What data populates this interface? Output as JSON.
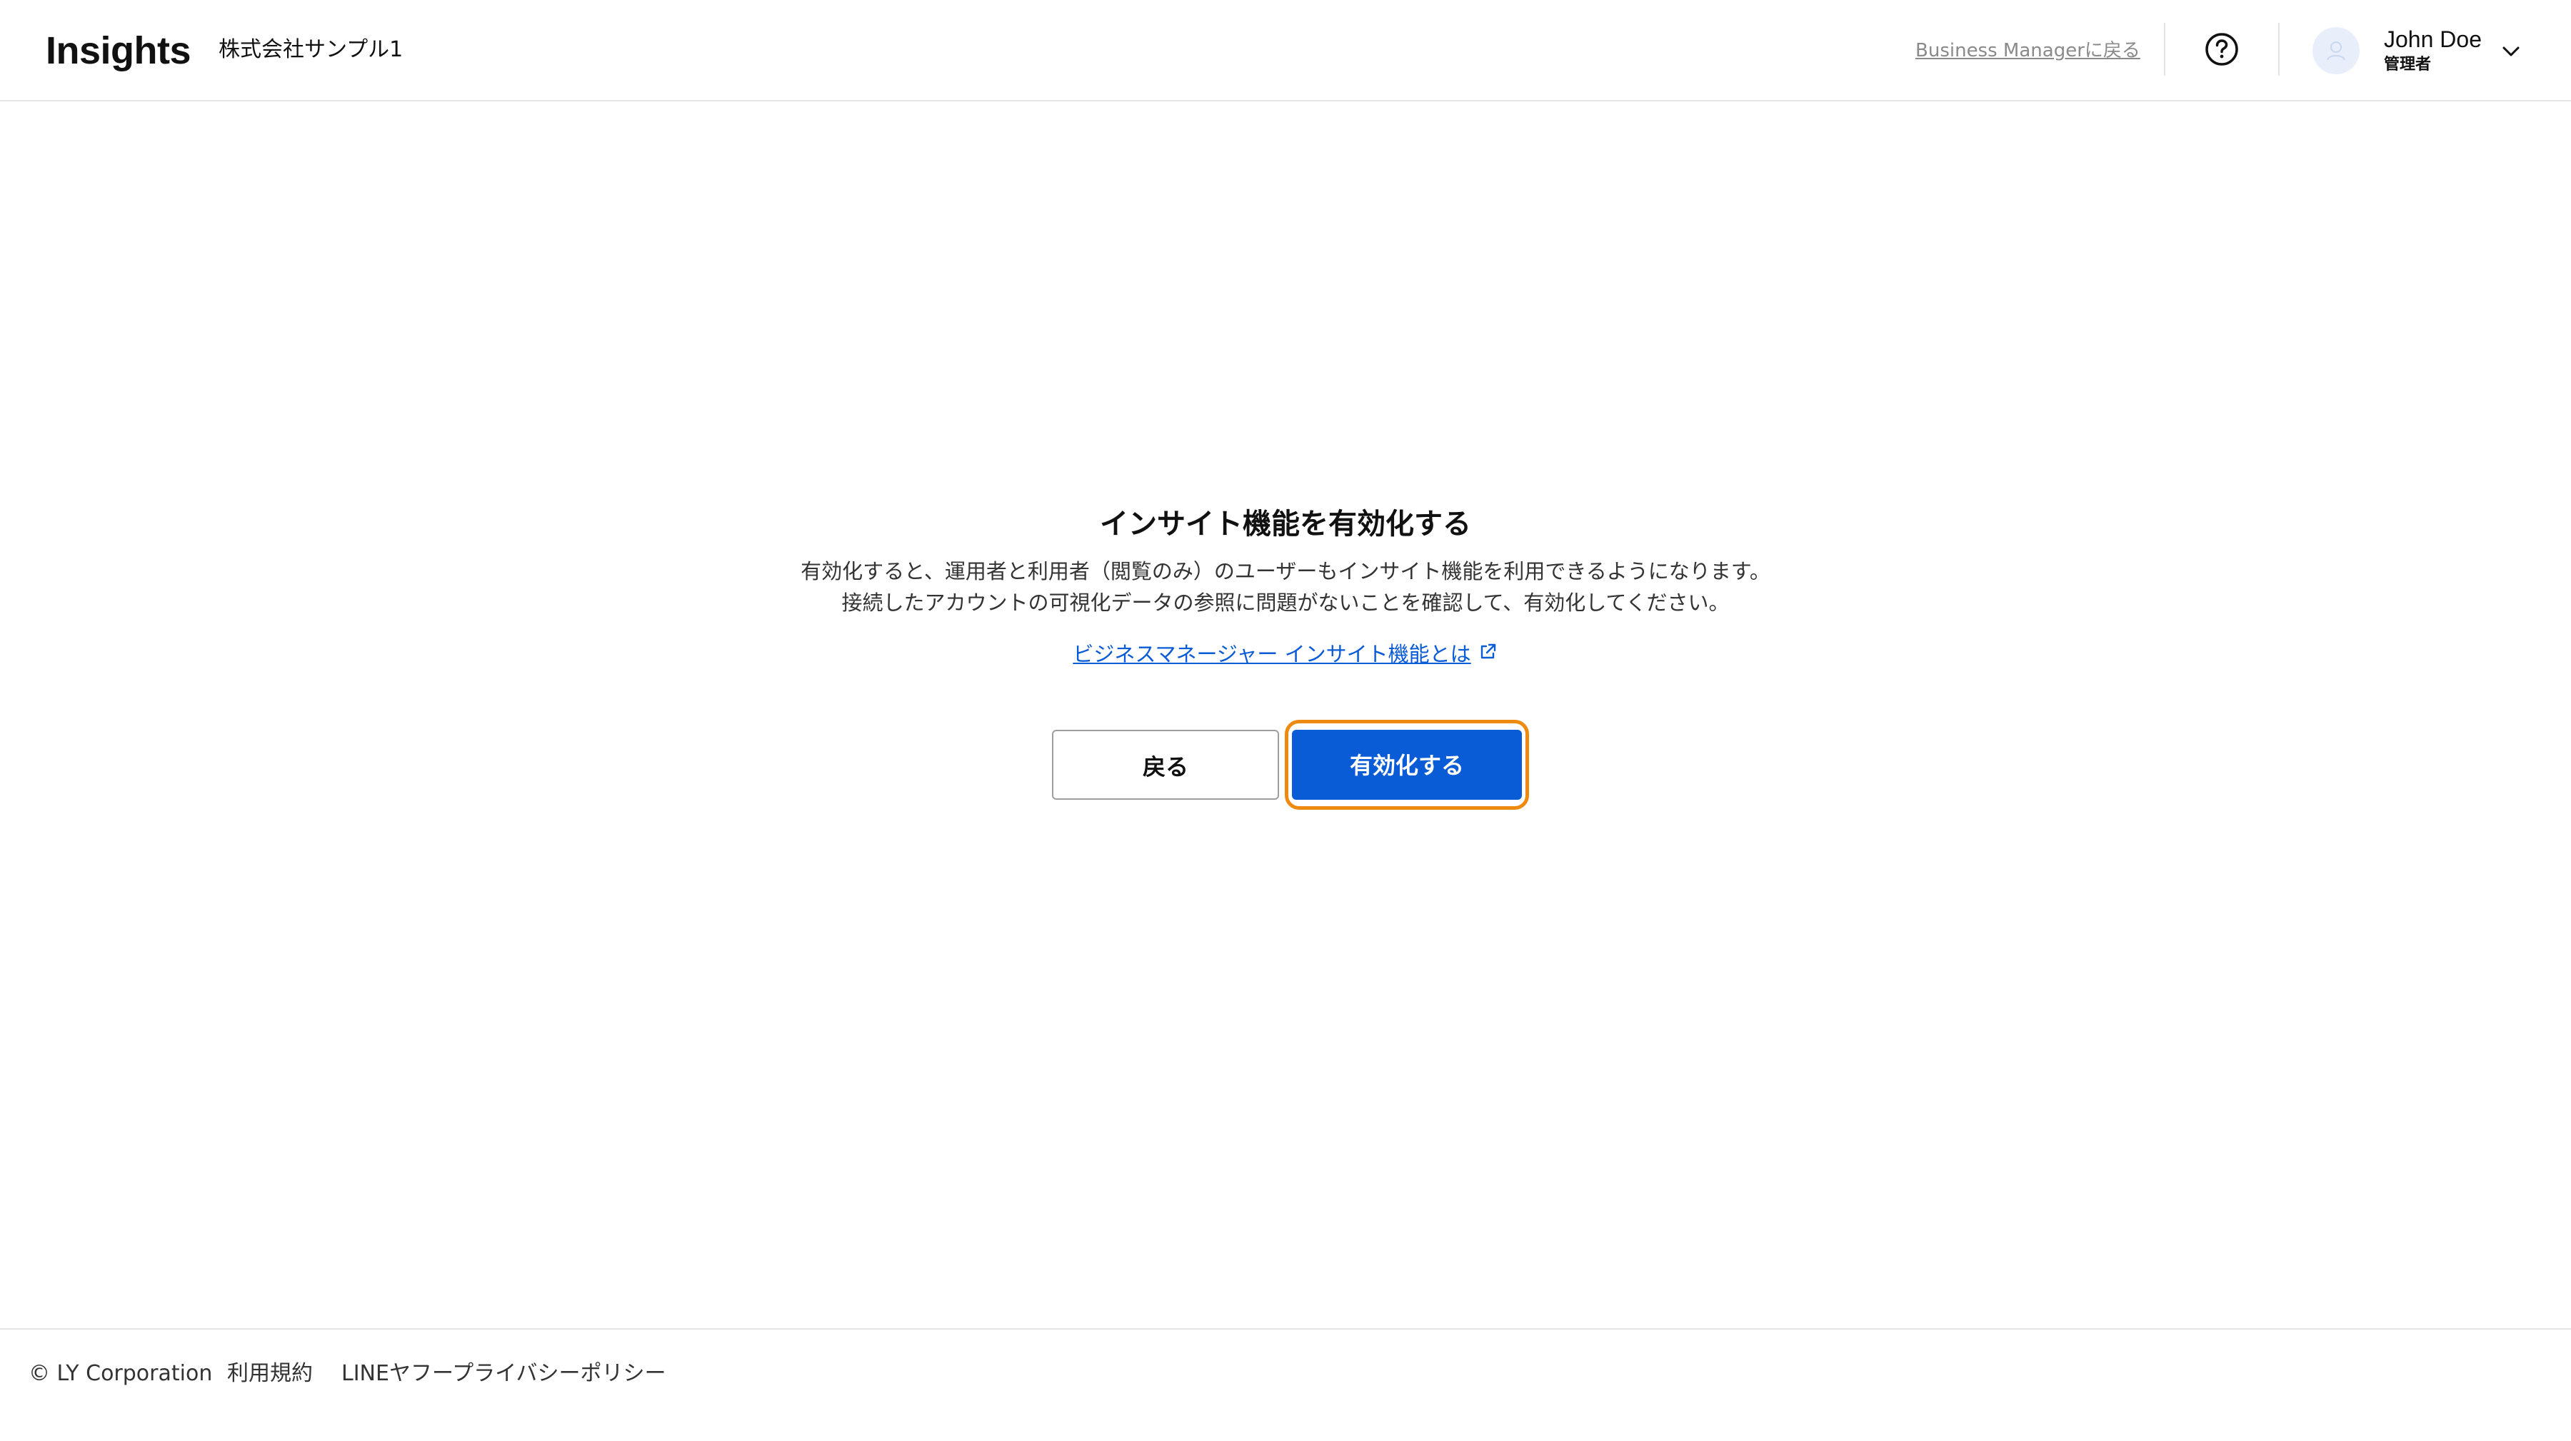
{
  "header": {
    "brand": "Insights",
    "org_name": "株式会社サンプル1",
    "business_manager_link": "Business Managerに戻る",
    "user": {
      "name": "John Doe",
      "role": "管理者"
    }
  },
  "main": {
    "title": "インサイト機能を有効化する",
    "description_line1": "有効化すると、運用者と利用者（閲覧のみ）のユーザーもインサイト機能を利用できるようになります。",
    "description_line2": "接続したアカウントの可視化データの参照に問題がないことを確認して、有効化してください。",
    "learn_more_link": "ビジネスマネージャー インサイト機能とは",
    "back_button": "戻る",
    "enable_button": "有効化する"
  },
  "footer": {
    "copyright": "© LY Corporation",
    "terms": "利用規約",
    "privacy": "LINEヤフープライバシーポリシー"
  },
  "colors": {
    "primary": "#0a5bd6",
    "focus_ring": "#ef8a10",
    "link": "#0a5bd6",
    "muted_text": "#8a8a8a"
  },
  "icons": {
    "help": "question-circle-icon",
    "avatar": "user-avatar-icon",
    "dropdown": "chevron-down-icon",
    "external": "external-link-icon"
  }
}
